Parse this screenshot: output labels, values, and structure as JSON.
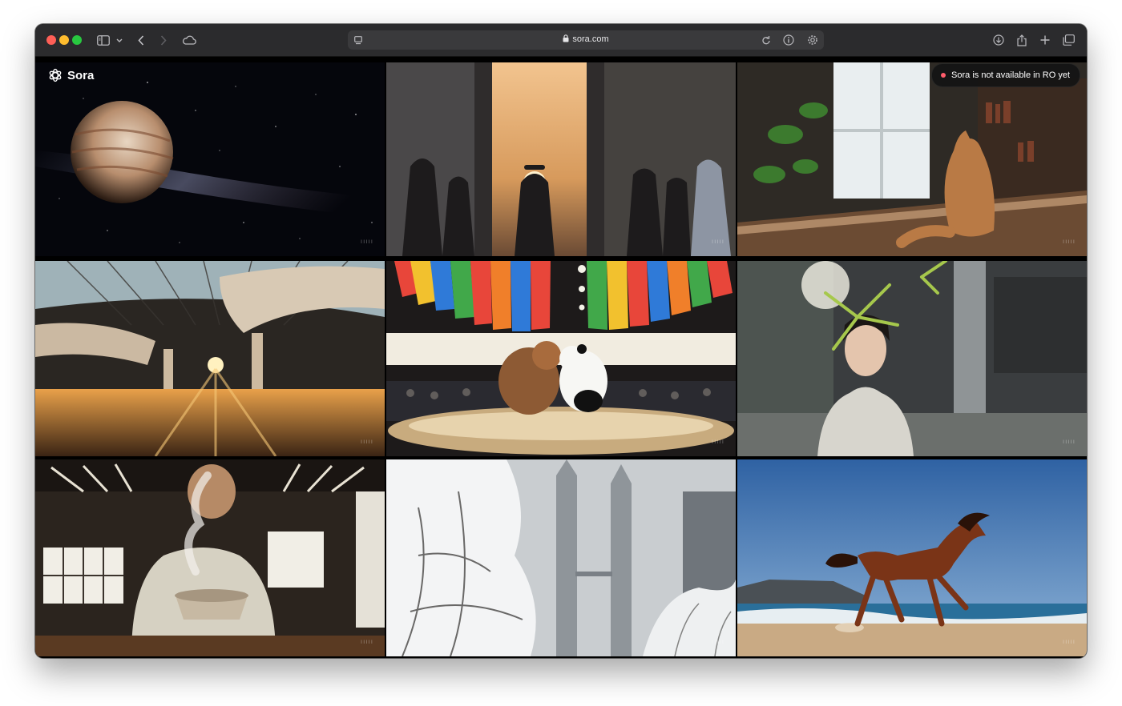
{
  "browser": {
    "url": "sora.com",
    "traffic_lights": [
      "close",
      "minimize",
      "zoom"
    ],
    "toolbar_icons_left": [
      "sidebar-icon",
      "chevron-down-icon",
      "back-icon",
      "forward-icon",
      "cloud-icon"
    ],
    "toolbar_icons_right": [
      "reload-icon",
      "info-icon",
      "gear-icon",
      "download-icon",
      "share-icon",
      "plus-icon",
      "tabs-icon"
    ]
  },
  "app": {
    "name": "Sora",
    "notice": "Sora is not available in RO yet",
    "notice_dot_color": "#ff5d6c"
  },
  "gallery": {
    "tiles": [
      {
        "subject": "planet-in-space"
      },
      {
        "subject": "people-in-sunlit-courtyard"
      },
      {
        "subject": "cat-on-table-by-window"
      },
      {
        "subject": "atrium-with-glass-dome"
      },
      {
        "subject": "bear-and-panda-sumo"
      },
      {
        "subject": "woman-under-bamboo"
      },
      {
        "subject": "man-with-steaming-tea"
      },
      {
        "subject": "snowy-city-towers"
      },
      {
        "subject": "horse-running-on-beach"
      }
    ]
  }
}
